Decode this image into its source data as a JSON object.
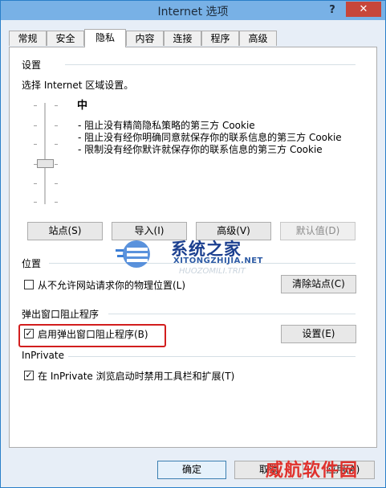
{
  "window": {
    "title": "Internet 选项",
    "help_label": "?",
    "close_label": "✕"
  },
  "tabs": [
    {
      "label": "常规"
    },
    {
      "label": "安全"
    },
    {
      "label": "隐私"
    },
    {
      "label": "内容"
    },
    {
      "label": "连接"
    },
    {
      "label": "程序"
    },
    {
      "label": "高级"
    }
  ],
  "settings": {
    "title": "设置",
    "instruction": "选择 Internet 区域设置。",
    "level": "中",
    "bullets": [
      "- 阻止没有精简隐私策略的第三方 Cookie",
      "- 阻止没有经你明确同意就保存你的联系信息的第三方 Cookie",
      "- 限制没有经你默许就保存你的联系信息的第三方 Cookie"
    ],
    "buttons": {
      "sites": "站点(S)",
      "import": "导入(I)",
      "advanced": "高级(V)",
      "default": "默认值(D)"
    }
  },
  "location": {
    "title": "位置",
    "checkbox_label": "从不允许网站请求你的物理位置(L)",
    "checked": false,
    "clear_button": "清除站点(C)"
  },
  "popup": {
    "title": "弹出窗口阻止程序",
    "checkbox_label": "启用弹出窗口阻止程序(B)",
    "checked": true,
    "settings_button": "设置(E)"
  },
  "inprivate": {
    "title": "InPrivate",
    "checkbox_label": "在 InPrivate 浏览启动时禁用工具栏和扩展(T)",
    "checked": true
  },
  "footer": {
    "ok": "确定",
    "cancel": "取消",
    "apply": "应用(A)"
  },
  "watermarks": {
    "brand": "系统之家",
    "url": "XITONGZHIJIA.NET",
    "ghost": "HUOZOMILI.TRIT",
    "bottom": "威航软件园"
  },
  "colors": {
    "accent": "#78b1e6",
    "close": "#c7463a",
    "highlight": "#d21e1e"
  }
}
